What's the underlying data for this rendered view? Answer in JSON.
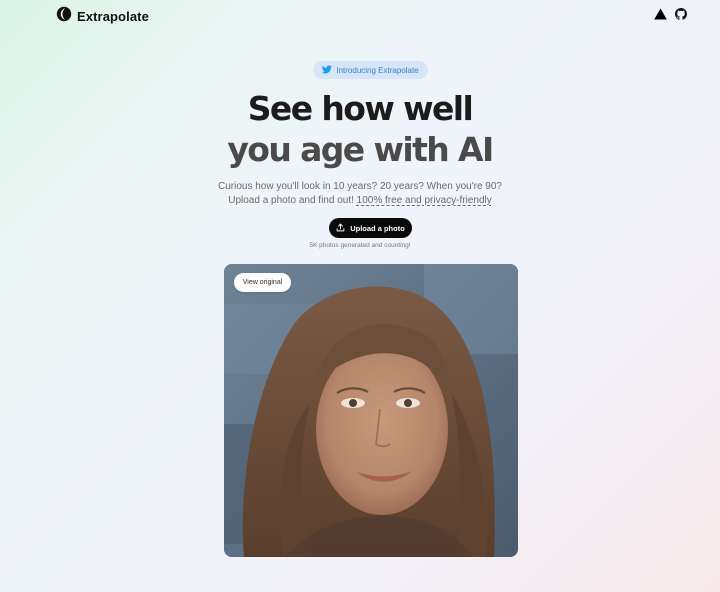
{
  "header": {
    "brand_name": "Extrapolate",
    "icons": [
      "extrapolate-logo-icon",
      "triangle-icon",
      "github-icon"
    ]
  },
  "hero": {
    "announcement": "Introducing Extrapolate",
    "announcement_icon": "twitter-icon",
    "headline_line1": "See how well",
    "headline_line2": "you age with AI",
    "subtitle_line1": "Curious how you'll look in 10 years? 20 years? When you're 90?",
    "subtitle_line2_prefix": "Upload a photo and find out!",
    "subtitle_link": "100% free and privacy-friendly"
  },
  "cta": {
    "upload_label": "Upload a photo",
    "upload_icon": "upload-icon",
    "counter_text": "5K photos generated and counting!"
  },
  "preview": {
    "view_original_label": "View original"
  },
  "colors": {
    "accent_twitter": "#1d9bf0",
    "pill_bg": "#d6e6f8",
    "button_bg": "#0a0a0a"
  }
}
